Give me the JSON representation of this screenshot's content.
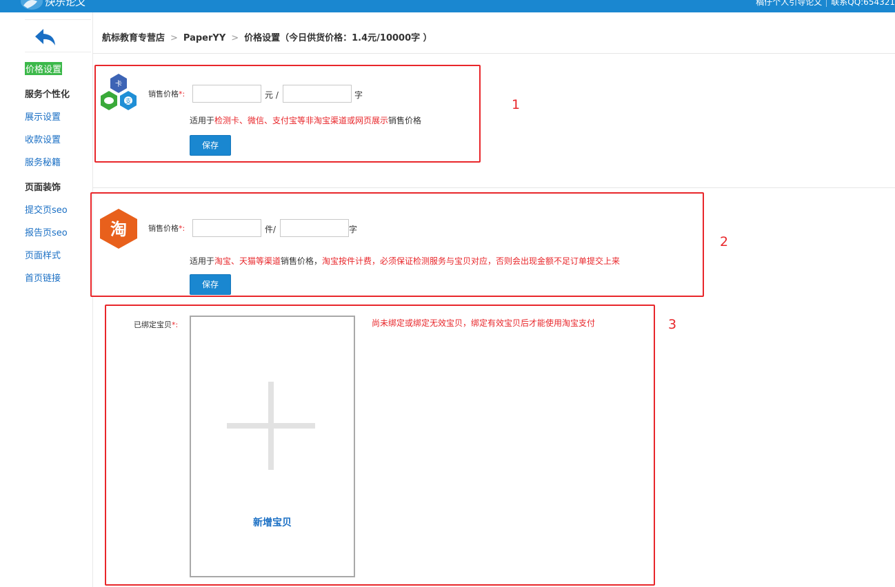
{
  "header": {
    "top_right_link_1": "稿仔个人引导论文",
    "top_right_link_2": "联系QQ:654321"
  },
  "sidebar": {
    "items": [
      {
        "label": "价格设置",
        "active": true
      },
      {
        "label": "服务个性化",
        "group": true
      },
      {
        "label": "展示设置"
      },
      {
        "label": "收款设置"
      },
      {
        "label": "服务秘籍"
      },
      {
        "label": "页面装饰",
        "group": true
      },
      {
        "label": "提交页seo"
      },
      {
        "label": "报告页seo"
      },
      {
        "label": "页面样式"
      },
      {
        "label": "首页链接"
      }
    ]
  },
  "breadcrumb": {
    "store": "航标教育专营店",
    "product": "PaperYY",
    "current": "价格设置（今日供货价格：1.4元/10000字 ）"
  },
  "section1": {
    "number": "1",
    "label": "销售价格",
    "required_mark": "*:",
    "price_value": "",
    "unit_price": "元 /",
    "words_value": "",
    "unit_words": "字",
    "note_prefix": "适用于",
    "note_highlight": "检测卡、微信、支付宝等非淘宝渠道或网页展示",
    "note_suffix": "销售价格",
    "save_label": "保存"
  },
  "section2": {
    "number": "2",
    "label": "销售价格",
    "required_mark": "*:",
    "price_value": "",
    "unit_price": "件/",
    "words_value": "",
    "unit_words": "字",
    "note_prefix": "适用于",
    "note_highlight_1": "淘宝、天猫等渠道",
    "note_mid": "销售价格，",
    "note_highlight_2": "淘宝按件计费，必须保证检测服务与宝贝对应，否则会出现金额不足订单提交上来",
    "save_label": "保存",
    "icon_glyph": "淘"
  },
  "section3": {
    "number": "3",
    "label": "已绑定宝贝",
    "required_mark": "*:",
    "add_label": "新增宝贝",
    "warning": "尚未绑定或绑定无效宝贝，绑定有效宝贝后才能使用淘宝支付"
  },
  "colors": {
    "brand_blue": "#1a87d0",
    "highlight_red": "#e8262a",
    "active_green": "#3cb84a",
    "taobao_orange": "#e8601c"
  }
}
